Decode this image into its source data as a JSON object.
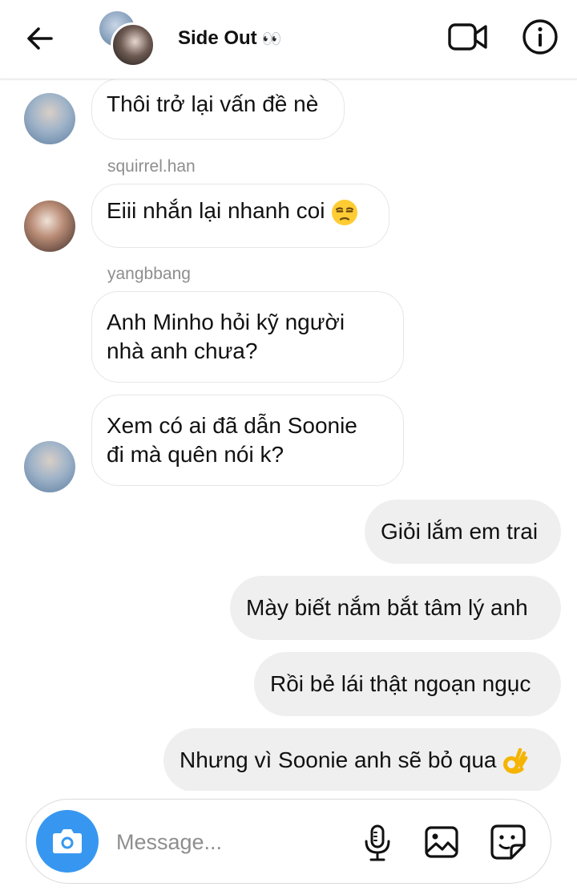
{
  "header": {
    "back_icon": "arrow-left-icon",
    "title": "Side Out",
    "title_emoji": "👀",
    "video_icon": "video-camera-icon",
    "info_icon": "info-circle-icon"
  },
  "messages": [
    {
      "side": "in",
      "text": "Thôi trở lại vấn đề nè",
      "avatar": "avatar-blue"
    },
    {
      "side": "in",
      "sender": "squirrel.han",
      "text": "Eiii nhắn lại nhanh coi",
      "emoji": "😒",
      "avatar": "avatar-warm"
    },
    {
      "side": "in",
      "sender": "yangbbang",
      "text_lines": [
        "Anh Minho hỏi kỹ người",
        "nhà anh chưa?"
      ]
    },
    {
      "side": "in",
      "text_lines": [
        "Xem có ai đã dẫn Soonie",
        "đi mà quên nói k?"
      ],
      "avatar": "avatar-blue"
    },
    {
      "side": "out",
      "text": "Giỏi lắm em trai"
    },
    {
      "side": "out",
      "text": "Mày biết nắm bắt tâm lý anh"
    },
    {
      "side": "out",
      "text": "Rồi bẻ lái thật ngoạn ngục"
    },
    {
      "side": "out",
      "text": "Nhưng vì Soonie anh sẽ bỏ qua",
      "emoji": "👌"
    }
  ],
  "composer": {
    "camera_icon": "camera-icon",
    "placeholder": "Message...",
    "mic_icon": "microphone-icon",
    "gallery_icon": "image-gallery-icon",
    "sticker_icon": "sticker-icon"
  },
  "colors": {
    "accent": "#3797f0",
    "outgoing_bubble": "#efefef",
    "incoming_border": "#e6e6e6",
    "sender_text": "#8e8e8e"
  }
}
